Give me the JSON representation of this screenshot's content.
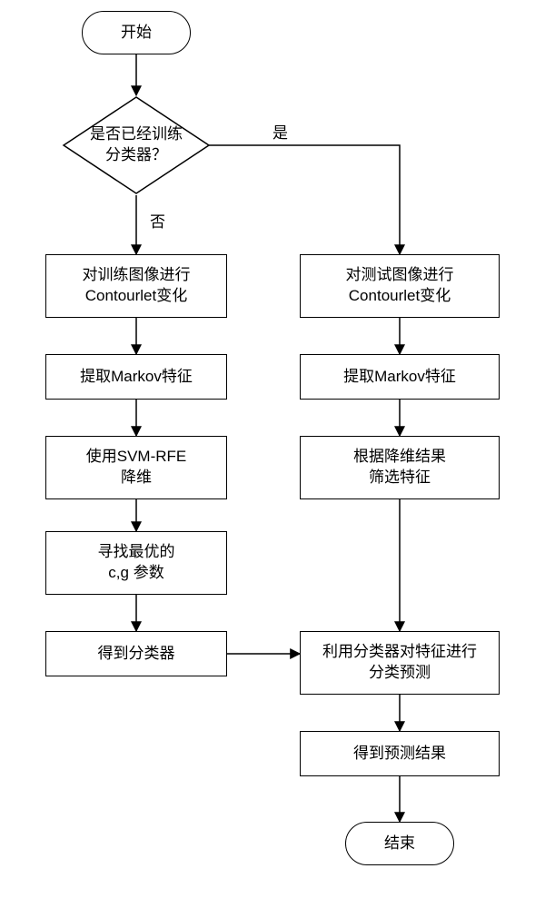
{
  "flow": {
    "start": "开始",
    "decision": "是否已经训练\n分类器？",
    "yes": "是",
    "no": "否",
    "left": {
      "s1": "对训练图像进行\nContourlet变化",
      "s2": "提取Markov特征",
      "s3": "使用SVM-RFE\n降维",
      "s4": "寻找最优的\nc,g 参数",
      "s5": "得到分类器"
    },
    "right": {
      "s1": "对测试图像进行\nContourlet变化",
      "s2": "提取Markov特征",
      "s3": "根据降维结果\n筛选特征",
      "s4": "利用分类器对特征进行\n分类预测",
      "s5": "得到预测结果"
    },
    "end": "结束"
  }
}
